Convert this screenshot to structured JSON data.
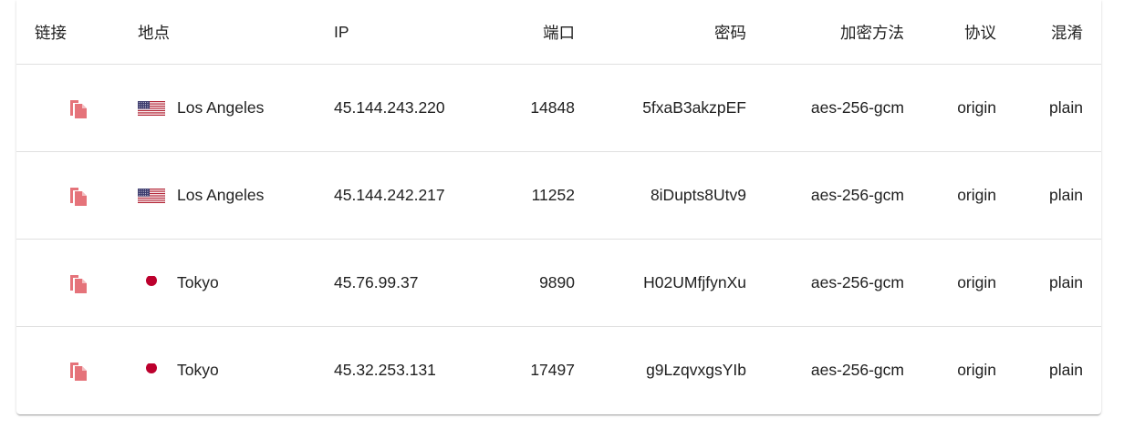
{
  "colors": {
    "copy_icon": "#e5737a",
    "jp_red": "#bc002d",
    "us_red": "#b22234",
    "us_blue": "#3c3b6e",
    "divider": "#e0e0e0"
  },
  "table": {
    "headers": {
      "link": "链接",
      "location": "地点",
      "ip": "IP",
      "port": "端口",
      "password": "密码",
      "method": "加密方法",
      "protocol": "协议",
      "obfs": "混淆"
    },
    "rows": [
      {
        "flag": "us-flag-icon",
        "location": "Los Angeles",
        "ip": "45.144.243.220",
        "port": "14848",
        "password": "5fxaB3akzpEF",
        "method": "aes-256-gcm",
        "protocol": "origin",
        "obfs": "plain"
      },
      {
        "flag": "us-flag-icon",
        "location": "Los Angeles",
        "ip": "45.144.242.217",
        "port": "11252",
        "password": "8iDupts8Utv9",
        "method": "aes-256-gcm",
        "protocol": "origin",
        "obfs": "plain"
      },
      {
        "flag": "jp-flag-icon",
        "location": "Tokyo",
        "ip": "45.76.99.37",
        "port": "9890",
        "password": "H02UMfjfynXu",
        "method": "aes-256-gcm",
        "protocol": "origin",
        "obfs": "plain"
      },
      {
        "flag": "jp-flag-icon",
        "location": "Tokyo",
        "ip": "45.32.253.131",
        "port": "17497",
        "password": "g9LzqvxgsYIb",
        "method": "aes-256-gcm",
        "protocol": "origin",
        "obfs": "plain"
      }
    ]
  }
}
